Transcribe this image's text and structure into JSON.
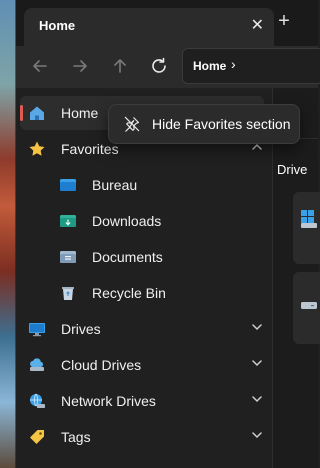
{
  "tab": {
    "title": "Home",
    "close": "✕",
    "new_tab": "+"
  },
  "toolbar": {
    "address_segment": "Home",
    "address_chevron": "›"
  },
  "sidebar": {
    "items": [
      {
        "label": "Home",
        "icon": "home-icon",
        "selected": true
      },
      {
        "label": "Favorites",
        "icon": "star-icon",
        "expanded": true
      },
      {
        "label": "Bureau",
        "icon": "desktop-folder-icon"
      },
      {
        "label": "Downloads",
        "icon": "downloads-folder-icon"
      },
      {
        "label": "Documents",
        "icon": "documents-folder-icon"
      },
      {
        "label": "Recycle Bin",
        "icon": "recycle-bin-icon"
      },
      {
        "label": "Drives",
        "icon": "monitor-icon"
      },
      {
        "label": "Cloud Drives",
        "icon": "cloud-drive-icon"
      },
      {
        "label": "Network Drives",
        "icon": "network-drive-icon"
      },
      {
        "label": "Tags",
        "icon": "tag-icon"
      }
    ]
  },
  "right_pane": {
    "section_title": "Drive"
  },
  "tooltip": {
    "label": "Hide Favorites section",
    "icon": "unpin-icon"
  },
  "colors": {
    "accent": "#e05b52",
    "background": "#202020"
  }
}
